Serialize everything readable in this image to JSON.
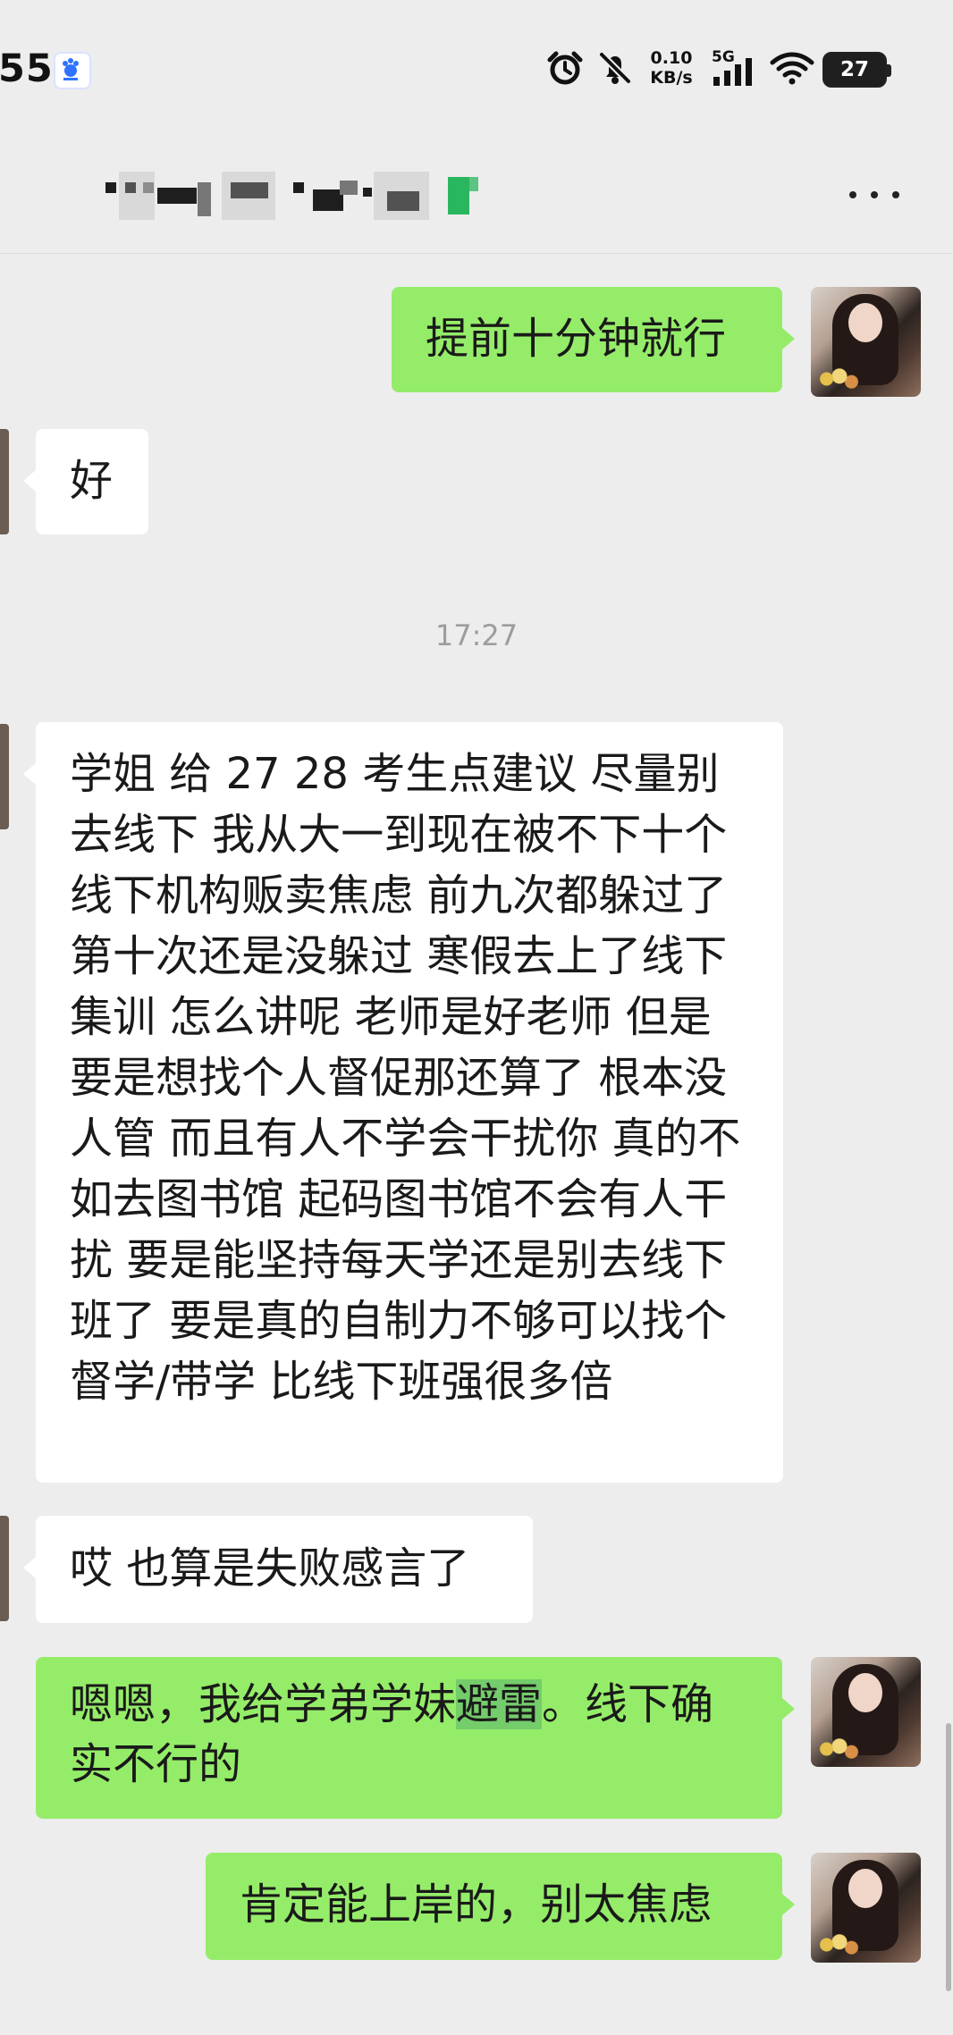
{
  "status_bar": {
    "time": "55",
    "network_speed": [
      "0.10",
      "KB/s"
    ],
    "signal_label": "5G",
    "battery_level": "27",
    "icons": [
      "baidu-icon",
      "alarm-icon",
      "mute-icon",
      "signal-icon",
      "wifi-icon",
      "battery-icon"
    ]
  },
  "header": {
    "title": "",
    "more_icon": "more-icon"
  },
  "timestamps": [
    "17:27"
  ],
  "messages": [
    {
      "side": "right",
      "text": "提前十分钟就行"
    },
    {
      "side": "left",
      "text": "好"
    },
    {
      "side": "left",
      "text": "学姐 给 27 28 考生点建议 尽量别去线下 我从大一到现在被不下十个线下机构贩卖焦虑 前九次都躲过了 第十次还是没躲过 寒假去上了线下集训 怎么讲呢 老师是好老师 但是要是想找个人督促那还算了 根本没人管 而且有人不学会干扰你 真的不如去图书馆 起码图书馆不会有人干扰 要是能坚持每天学还是别去线下班了 要是真的自制力不够可以找个督学/带学 比线下班强很多倍"
    },
    {
      "side": "left",
      "text": "哎 也算是失败感言了"
    },
    {
      "side": "right",
      "text": [
        "嗯嗯，我给学弟学妹",
        "避雷",
        "。线下确实不行的"
      ]
    },
    {
      "side": "right",
      "text": "肯定能上岸的，别太焦虑"
    }
  ],
  "colors": {
    "background": "#ededed",
    "right_bubble": "#95ec69",
    "left_bubble": "#ffffff",
    "highlight": "#74cc6b",
    "timestamp": "#9d9d9d"
  }
}
